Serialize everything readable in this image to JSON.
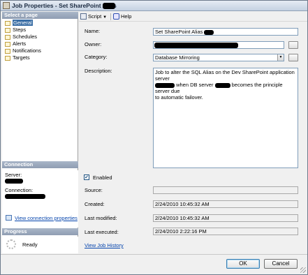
{
  "window": {
    "title": "Job Properties - Set SharePoint Alias"
  },
  "sidebar": {
    "select_page_header": "Select a page",
    "pages": [
      {
        "label": "General",
        "selected": true
      },
      {
        "label": "Steps",
        "selected": false
      },
      {
        "label": "Schedules",
        "selected": false
      },
      {
        "label": "Alerts",
        "selected": false
      },
      {
        "label": "Notifications",
        "selected": false
      },
      {
        "label": "Targets",
        "selected": false
      }
    ],
    "connection_header": "Connection",
    "server_label": "Server:",
    "connection_label": "Connection:",
    "view_connection_link": "View connection properties",
    "progress_header": "Progress",
    "progress_status": "Ready"
  },
  "toolbar": {
    "script_label": "Script",
    "help_label": "Help"
  },
  "form": {
    "name_label": "Name:",
    "name_value": "Set SharePoint Alias",
    "owner_label": "Owner:",
    "owner_value": "",
    "category_label": "Category:",
    "category_value": "Database Mirroring",
    "description_label": "Description:",
    "description_line1": "Job to alter the SQL Alias on the Dev SharePoint application server",
    "description_line2a": "when DB server",
    "description_line2b": "becomes the principle server due",
    "description_line3": "to automatic failover.",
    "enabled_label": "Enabled",
    "enabled_checked": true,
    "source_label": "Source:",
    "source_value": "",
    "created_label": "Created:",
    "created_value": "2/24/2010 10:45:32 AM",
    "last_modified_label": "Last modified:",
    "last_modified_value": "2/24/2010 10:45:32 AM",
    "last_executed_label": "Last executed:",
    "last_executed_value": "2/24/2010 2:22:16 PM",
    "view_history_link": "View Job History"
  },
  "buttons": {
    "ok_label": "OK",
    "cancel_label": "Cancel"
  }
}
